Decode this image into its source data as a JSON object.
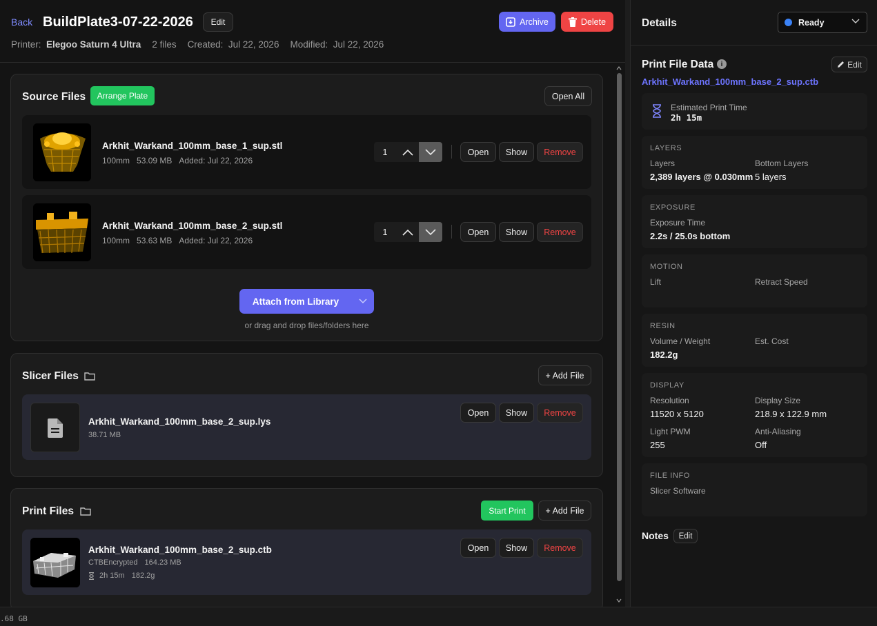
{
  "header": {
    "back": "Back",
    "title": "BuildPlate3-07-22-2026",
    "edit": "Edit",
    "archive": "Archive",
    "delete": "Delete",
    "printer_label": "Printer:",
    "printer_name": "Elegoo Saturn 4 Ultra",
    "files_count": "2 files",
    "created_label": "Created:",
    "created": "Jul 22, 2026",
    "modified_label": "Modified:",
    "modified": "Jul 22, 2026"
  },
  "source": {
    "title": "Source Files",
    "arrange": "Arrange Plate",
    "open_all": "Open All",
    "files": [
      {
        "name": "Arkhit_Warkand_100mm_base_1_sup.stl",
        "size_label": "100mm",
        "size": "53.09 MB",
        "added": "Added: Jul 22, 2026",
        "qty": "1"
      },
      {
        "name": "Arkhit_Warkand_100mm_base_2_sup.stl",
        "size_label": "100mm",
        "size": "53.63 MB",
        "added": "Added: Jul 22, 2026",
        "qty": "1"
      }
    ],
    "attach": "Attach from Library",
    "drop_hint": "or drag and drop files/folders here"
  },
  "actions": {
    "open": "Open",
    "show": "Show",
    "remove": "Remove",
    "add_file": "+ Add File",
    "start_print": "Start Print"
  },
  "slicer": {
    "title": "Slicer Files",
    "file": {
      "name": "Arkhit_Warkand_100mm_base_2_sup.lys",
      "size": "38.71 MB"
    }
  },
  "print": {
    "title": "Print Files",
    "file": {
      "name": "Arkhit_Warkand_100mm_base_2_sup.ctb",
      "format": "CTBEncrypted",
      "size": "164.23 MB",
      "time": "2h 15m",
      "weight": "182.2g"
    }
  },
  "details": {
    "title": "Details",
    "status": "Ready",
    "pfd_title": "Print File Data",
    "pfd_edit": "Edit",
    "pfd_file": "Arkhit_Warkand_100mm_base_2_sup.ctb",
    "est_label": "Estimated Print Time",
    "est_value": "2h 15m",
    "layers": {
      "head": "LAYERS",
      "l1": "Layers",
      "v1": "2,389 layers @ 0.030mm",
      "l2": "Bottom Layers",
      "v2": "5 layers"
    },
    "exposure": {
      "head": "EXPOSURE",
      "l1": "Exposure Time",
      "v1": "2.2s / 25.0s bottom"
    },
    "motion": {
      "head": "MOTION",
      "l1": "Lift",
      "l2": "Retract Speed"
    },
    "resin": {
      "head": "RESIN",
      "l1": "Volume / Weight",
      "v1": "182.2g",
      "l2": "Est. Cost"
    },
    "display": {
      "head": "DISPLAY",
      "l1": "Resolution",
      "v1": "11520 x 5120",
      "l2": "Display Size",
      "v2": "218.9 x 122.9 mm",
      "l3": "Light PWM",
      "v3": "255",
      "l4": "Anti-Aliasing",
      "v4": "Off"
    },
    "fileinfo": {
      "head": "FILE INFO",
      "l1": "Slicer Software"
    },
    "notes": "Notes",
    "notes_edit": "Edit"
  },
  "statusbar": {
    "text": ".68 GB"
  },
  "colors": {
    "accent": "#6366f1",
    "danger": "#ef4444",
    "success": "#22c55e",
    "link": "#6d74ff",
    "status_ready": "#3b82f6"
  }
}
